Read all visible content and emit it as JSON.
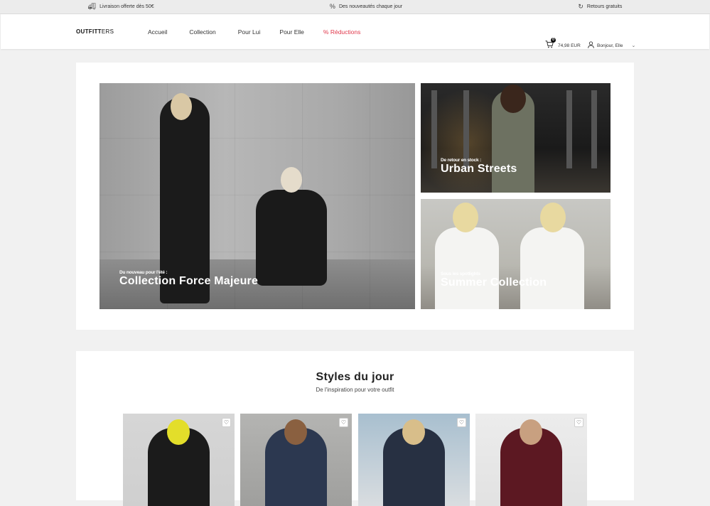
{
  "topbar": {
    "shipping": "Livraison offerte dès 50€",
    "new": "Des nouveautés chaque jour",
    "returns": "Retours gratuits"
  },
  "nav": {
    "logo_bold": "OUTFITT",
    "logo_thin": "ERS",
    "menu": [
      "Accueil",
      "Collection",
      "Pour Lui",
      "Pour Elle",
      "% Réductions"
    ],
    "cart_count": "0",
    "cart_total": "74,98 EUR",
    "user_greeting": "Bonjour, Elle"
  },
  "hero": {
    "main": {
      "kicker": "Du nouveau pour l'été :",
      "title": "Collection Force Majeure"
    },
    "top_right": {
      "kicker": "De retour en stock :",
      "title": "Urban Streets"
    },
    "bottom_right": {
      "kicker": "Sous les spotlights",
      "title": "Summer Collection"
    }
  },
  "styles": {
    "title": "Styles du jour",
    "subtitle": "De l'inspiration pour votre outfit"
  },
  "icons": {
    "truck": "truck-icon",
    "percent": "percent-icon",
    "refresh": "refresh-icon",
    "cart": "cart-icon",
    "user": "user-icon",
    "heart": "heart-icon"
  },
  "colors": {
    "sale": "#e0384b",
    "background": "#f1f1f1"
  }
}
